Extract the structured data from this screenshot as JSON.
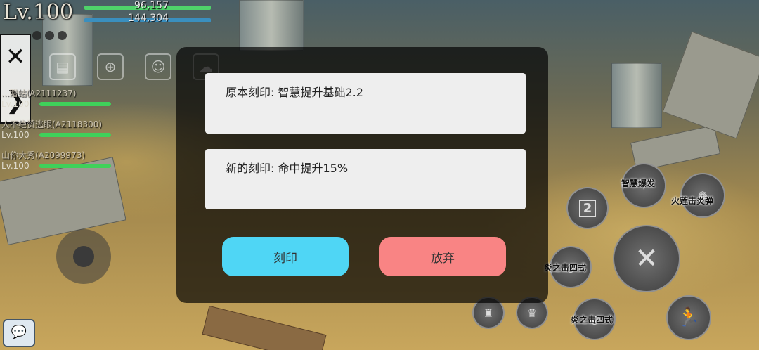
{
  "hud": {
    "level": "Lv.100",
    "hp_value": "96,157",
    "mp_value": "144,304",
    "hp_color": "#4fd36a",
    "mp_color": "#3a8fbf"
  },
  "side_panel": {
    "close_icon": "close-icon",
    "expand_icon": "chevron-right-icon"
  },
  "top_icons": [
    "document-icon",
    "target-icon",
    "support-icon",
    "cloud-icon"
  ],
  "party": [
    {
      "name": "...贈蛄(A2111237)",
      "level": "Lv.100",
      "hp_fraction": 1.0
    },
    {
      "name": "人不绝赞逃眼(A2118300)",
      "level": "Lv.100",
      "hp_fraction": 1.0
    },
    {
      "name": "山伱大秀(A2099973)",
      "level": "Lv.100",
      "hp_fraction": 1.0
    }
  ],
  "dialog": {
    "original_imprint": "原本刻印: 智慧提升基础2.2",
    "new_imprint": "新的刻印: 命中提升15%",
    "confirm_label": "刻印",
    "discard_label": "放弃",
    "confirm_color": "#4fd6f5",
    "discard_color": "#f98484"
  },
  "skills": {
    "wisdom_burst": "智慧爆发",
    "fire_lotus": "火莲击炎弹",
    "slot_number": "2",
    "flame_four_a": "炎之击四式",
    "flame_four_b": "炎之击四式"
  },
  "chat": {
    "icon": "chat-icon"
  }
}
